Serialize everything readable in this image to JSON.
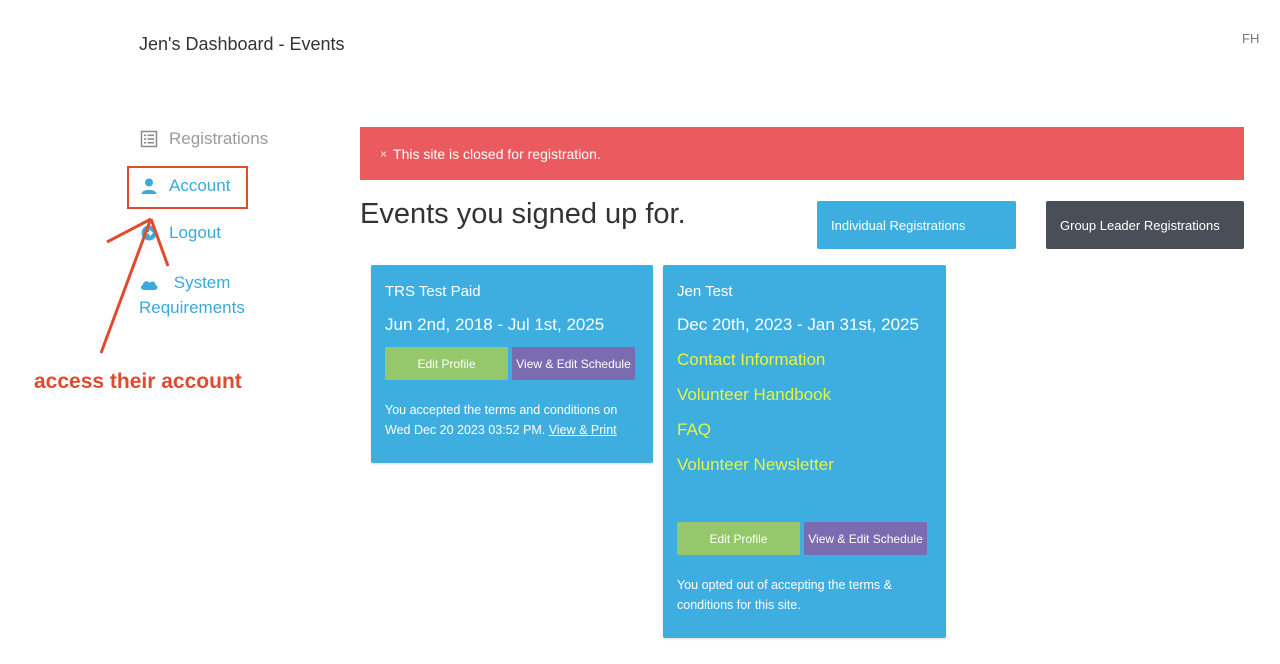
{
  "header": {
    "title": "Jen's Dashboard - Events",
    "avatar_initials": "FH"
  },
  "sidebar": {
    "items": [
      {
        "label": "Registrations",
        "icon": "list-icon"
      },
      {
        "label": "Account",
        "icon": "user-icon"
      },
      {
        "label": "Logout",
        "icon": "logout-icon"
      },
      {
        "label": "System Requirements",
        "icon": "cloud-icon"
      }
    ]
  },
  "annotation": {
    "callout_text": "access their account",
    "color": "#e04a2f"
  },
  "alert": {
    "close_glyph": "×",
    "message": "This site is closed for registration.",
    "color": "#ea5a5e"
  },
  "main": {
    "heading": "Events you signed up for.",
    "buttons": {
      "individual": "Individual Registrations",
      "group_leader": "Group Leader Registrations"
    }
  },
  "events": [
    {
      "name": "TRS Test Paid",
      "dates": "Jun 2nd, 2018 - Jul 1st, 2025",
      "edit_label": "Edit Profile",
      "schedule_label": "View & Edit Schedule",
      "note": "You accepted the terms and conditions on Wed Dec 20 2023 03:52 PM.",
      "note_link": "View & Print"
    },
    {
      "name": "Jen Test",
      "dates": "Dec 20th, 2023 - Jan 31st, 2025",
      "links": [
        "Contact Information",
        "Volunteer Handbook",
        "FAQ",
        "Volunteer Newsletter"
      ],
      "edit_label": "Edit Profile",
      "schedule_label": "View & Edit Schedule",
      "note": "You opted out of accepting the terms & conditions for this site."
    }
  ],
  "colors": {
    "accent": "#3eaee1",
    "dark_button": "#4a4e56",
    "edit_button": "#94c86b",
    "schedule_button": "#7b6bb0",
    "card_link": "#e6f53a"
  }
}
